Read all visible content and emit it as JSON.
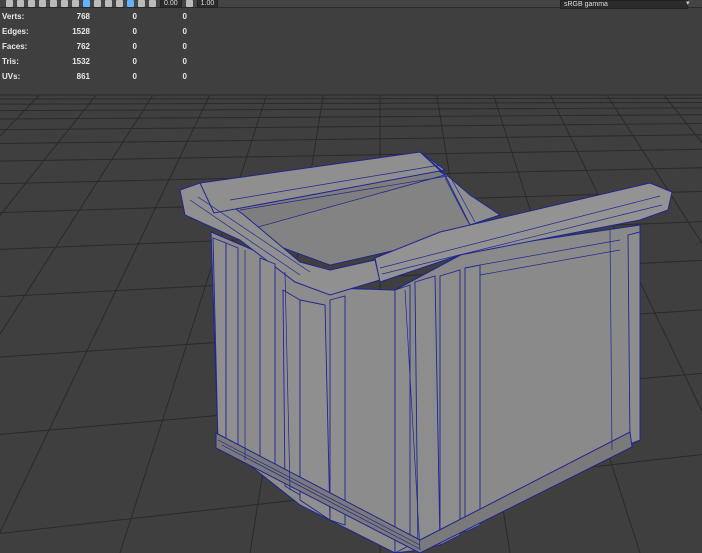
{
  "toolbar": {
    "field_value_1": "0.00",
    "field_value_2": "1.00",
    "color_space": "sRGB gamma",
    "menu_arrow": "▾"
  },
  "hud": {
    "rows": [
      {
        "label": "Verts:",
        "v1": "768",
        "v2": "0",
        "v3": "0"
      },
      {
        "label": "Edges:",
        "v1": "1528",
        "v2": "0",
        "v3": "0"
      },
      {
        "label": "Faces:",
        "v1": "762",
        "v2": "0",
        "v3": "0"
      },
      {
        "label": "Tris:",
        "v1": "1532",
        "v2": "0",
        "v3": "0"
      },
      {
        "label": "UVs:",
        "v1": "861",
        "v2": "0",
        "v3": "0"
      }
    ]
  },
  "colors": {
    "background": "#3f3f3f",
    "grid": "#2a2a2a",
    "mesh_fill": "#8a8a8a",
    "wireframe": "#2a2f9a"
  }
}
